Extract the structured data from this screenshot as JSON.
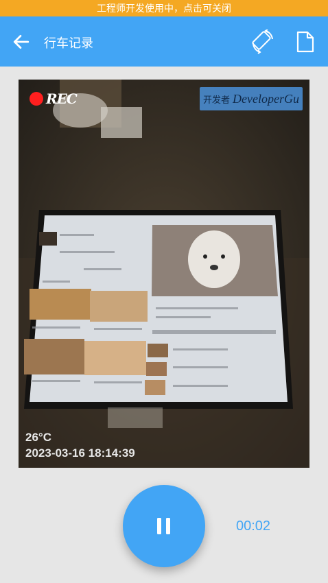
{
  "dev_banner": {
    "text": "工程师开发使用中，点击可关闭"
  },
  "app_bar": {
    "title": "行车记录",
    "back_icon": "arrow-left-icon",
    "rotate_icon": "screen-rotation-icon",
    "file_icon": "file-icon"
  },
  "preview": {
    "rec_label": "REC",
    "watermark_cn": "开发者",
    "watermark_en": "DeveloperGu",
    "temperature": "26°C",
    "datetime": "2023-03-16 18:14:39"
  },
  "controls": {
    "pause_icon": "pause-icon",
    "elapsed": "00:02"
  },
  "colors": {
    "banner": "#f4a823",
    "primary": "#42a5f5",
    "rec_dot": "#ff1f1f",
    "background": "#e6e6e6"
  }
}
